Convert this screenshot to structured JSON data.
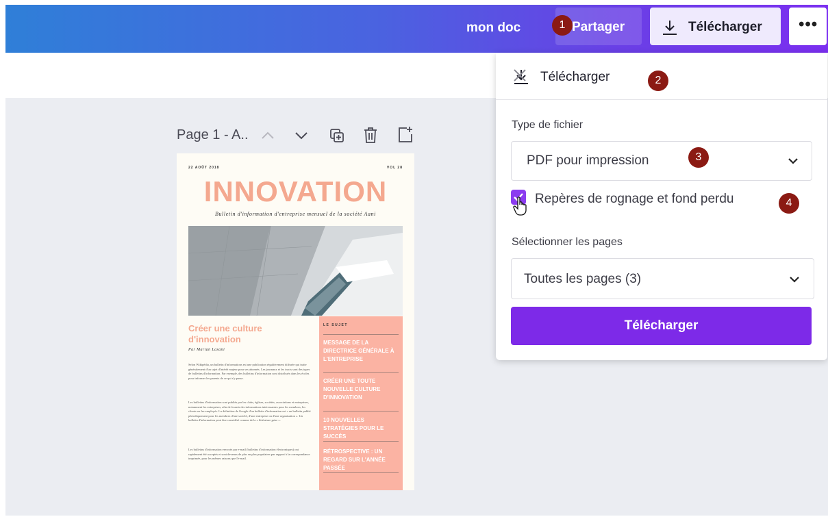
{
  "header": {
    "doc_name": "mon doc",
    "share_label": "Partager",
    "download_label": "Télécharger",
    "more_icon": "more-dots-icon"
  },
  "annotations": [
    "1",
    "2",
    "3",
    "4"
  ],
  "page_controls": {
    "page_label": "Page 1 - A..",
    "icons": [
      "chevron-up-icon",
      "chevron-down-icon",
      "duplicate-page-icon",
      "delete-page-icon",
      "add-page-icon"
    ]
  },
  "document": {
    "date": "22 AOÛT 2018",
    "volume": "VOL 28",
    "title": "INNOVATION",
    "subtitle": "Bulletin d'information d'entreprise mensuel de la société Aani",
    "article_title": "Créer une culture d'innovation",
    "byline": "Par Marian Lasani",
    "body_paragraphs": [
      "Selon Wikipédia, un bulletin d'informations est une publication régulièrement diffusée qui traite généralement d'un sujet d'intérêt majeur pour ses abonnés. Les journaux et les tracts sont des types de bulletins d'information. Par exemple, des bulletins d'information sont distribués dans les écoles pour informer les parents de ce qui s'y passe.",
      "Les bulletins d'information sont publiés par les clubs, églises, sociétés, associations et entreprises, notamment les entreprises, afin de fournir des informations intéressantes pour les membres, les clients ou les employés. La définition de Google d'un bulletin d'information est « un bulletin publié périodiquement pour les membres d'une société, d'une entreprise ou d'une organisation ». Un bulletin d'information peut être considéré comme de la « littérature grise ».",
      "Les bulletins d'information envoyés par e-mail (bulletins d'information électroniques) ont rapidement été acceptés et sont devenus de plus en plus populaires par rapport à la correspondance imprimée, pour les mêmes raisons que l'e-mail."
    ],
    "sidebar_heading": "LE SUJET",
    "sidebar_items": [
      "MESSAGE DE LA DIRECTRICE GÉNÉRALE À L'ENTREPRISE",
      "CRÉER UNE TOUTE NOUVELLE CULTURE D'INNOVATION",
      "10 NOUVELLES STRATÉGIES POUR LE SUCCÈS",
      "RÉTROSPECTIVE : UN REGARD SUR L'ANNÉE PASSÉE"
    ]
  },
  "download_panel": {
    "title": "Télécharger",
    "file_type_label": "Type de fichier",
    "file_type_value": "PDF pour impression",
    "crop_marks_label": "Repères de rognage et fond perdu",
    "crop_marks_checked": true,
    "pages_label": "Sélectionner les pages",
    "pages_value": "Toutes les pages (3)",
    "submit_label": "Télécharger"
  },
  "colors": {
    "accent": "#7d2ae8",
    "badge": "#8b1a13",
    "title_pink": "#f4a88f",
    "sidebar_pink": "#fbb3a3"
  }
}
